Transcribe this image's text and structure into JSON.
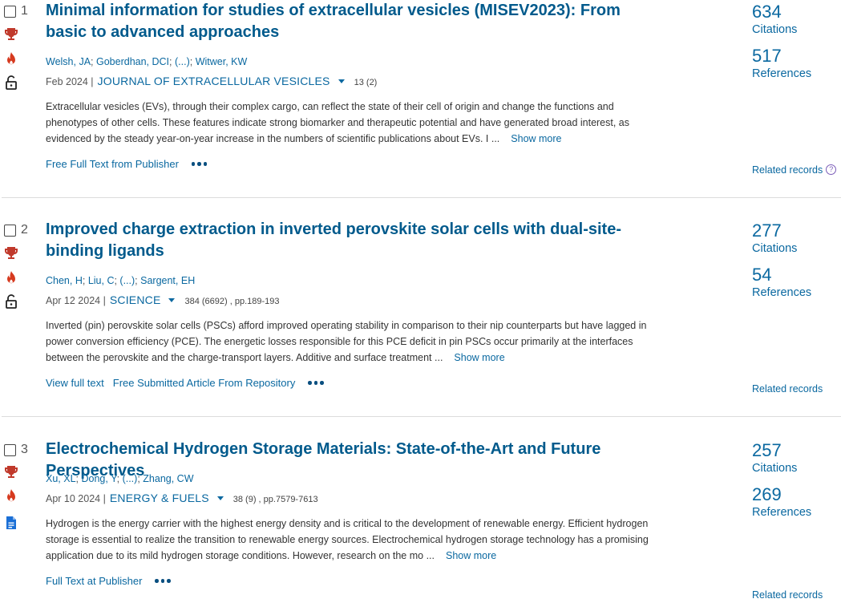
{
  "records": [
    {
      "num": "1",
      "title": "Minimal information for studies of extracellular vesicles (MISEV2023): From basic to advanced approaches",
      "authors": [
        "Welsh, JA",
        "Goberdhan, DCI",
        "(...)",
        "Witwer, KW"
      ],
      "date": "Feb 2024 |",
      "journal": "JOURNAL OF EXTRACELLULAR VESICLES",
      "volume": "13 (2)",
      "abstract": "Extracellular vesicles (EVs), through their complex cargo, can reflect the state of their cell of origin and change the functions and phenotypes of other cells. These features indicate strong biomarker and therapeutic potential and have generated broad interest, as evidenced by the steady year-on-year increase in the numbers of scientific publications about EVs. I ...",
      "show_more": "Show more",
      "links": [
        "Free Full Text from Publisher"
      ],
      "citations": "634",
      "citations_label": "Citations",
      "references": "517",
      "references_label": "References",
      "related": "Related records",
      "icons": [
        "trophy-icon",
        "hot-paper-icon",
        "open-access-icon"
      ]
    },
    {
      "num": "2",
      "title": "Improved charge extraction in inverted perovskite solar cells with dual-site-binding ligands",
      "authors": [
        "Chen, H",
        "Liu, C",
        "(...)",
        "Sargent, EH"
      ],
      "date": "Apr 12 2024 |",
      "journal": "SCIENCE",
      "volume": "384 (6692) , pp.189-193",
      "abstract": "Inverted (pin) perovskite solar cells (PSCs) afford improved operating stability in comparison to their nip counterparts but have lagged in power conversion efficiency (PCE). The energetic losses responsible for this PCE deficit in pin PSCs occur primarily at the interfaces between the perovskite and the charge-transport layers. Additive and surface treatment ...",
      "show_more": "Show more",
      "links": [
        "View full text",
        "Free Submitted Article From Repository"
      ],
      "citations": "277",
      "citations_label": "Citations",
      "references": "54",
      "references_label": "References",
      "related": "Related records",
      "icons": [
        "trophy-icon",
        "hot-paper-icon",
        "open-access-icon"
      ]
    },
    {
      "num": "3",
      "title": "Electrochemical Hydrogen Storage Materials: State-of-the-Art and Future Perspectives",
      "authors": [
        "Xu, XL",
        "Dong, Y",
        "(...)",
        "Zhang, CW"
      ],
      "date": "Apr 10 2024 |",
      "journal": "ENERGY & FUELS",
      "volume": "38 (9) , pp.7579-7613",
      "abstract": "Hydrogen is the energy carrier with the highest energy density and is critical to the development of renewable energy. Efficient hydrogen storage is essential to realize the transition to renewable energy sources. Electrochemical hydrogen storage technology has a promising application due to its mild hydrogen storage conditions. However, research on the mo ...",
      "show_more": "Show more",
      "links": [
        "Full Text at Publisher"
      ],
      "citations": "257",
      "citations_label": "Citations",
      "references": "269",
      "references_label": "References",
      "related": "Related records",
      "icons": [
        "trophy-icon",
        "hot-paper-icon",
        "review-document-icon"
      ]
    }
  ],
  "colors": {
    "link": "#0a68a0",
    "title": "#005a8c",
    "trophy": "#c0392b",
    "hot": "#d63a1f",
    "document": "#1a6fd6"
  }
}
